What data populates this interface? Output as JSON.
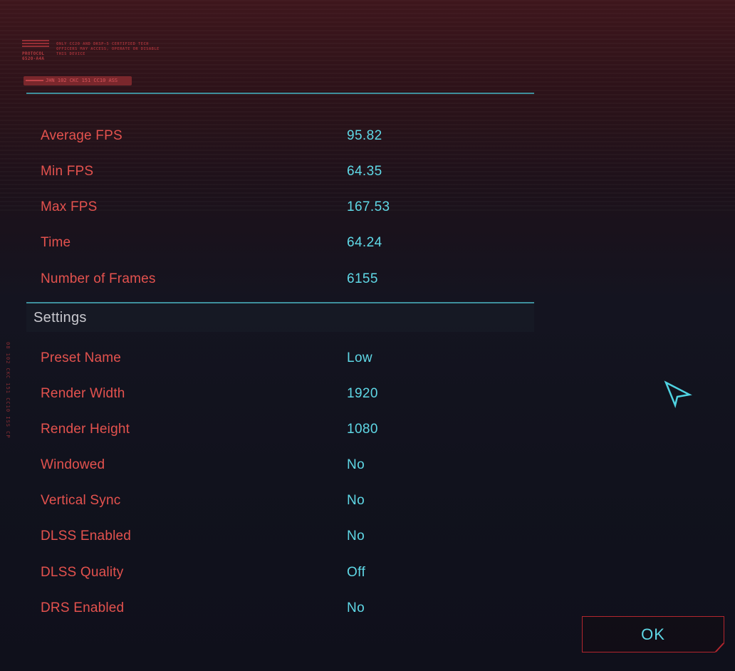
{
  "header": {
    "logo_text": "PROTOCOL 6520-A4A",
    "notice": "ONLY CC20 AND DKSP-5 CERTIFIED TECH OFFICERS MAY ACCESS, OPERATE OR DISABLE THIS DEVICE",
    "tag": "JHN 102 CKC 151 CC10 ASS",
    "side_code": "08 102 CKC 151 CC10 ISS CP"
  },
  "results": [
    {
      "label": "Average FPS",
      "value": "95.82"
    },
    {
      "label": "Min FPS",
      "value": "64.35"
    },
    {
      "label": "Max FPS",
      "value": "167.53"
    },
    {
      "label": "Time",
      "value": "64.24"
    },
    {
      "label": "Number of Frames",
      "value": "6155"
    }
  ],
  "settings": {
    "title": "Settings",
    "items": [
      {
        "label": "Preset Name",
        "value": "Low"
      },
      {
        "label": "Render Width",
        "value": "1920"
      },
      {
        "label": "Render Height",
        "value": "1080"
      },
      {
        "label": "Windowed",
        "value": "No"
      },
      {
        "label": "Vertical Sync",
        "value": "No"
      },
      {
        "label": "DLSS Enabled",
        "value": "No"
      },
      {
        "label": "DLSS Quality",
        "value": "Off"
      },
      {
        "label": "DRS Enabled",
        "value": "No"
      }
    ]
  },
  "ok_button": {
    "label": "OK"
  },
  "icons": {
    "cursor": "cursor-arrow-icon",
    "logo": "protocol-logo-icon"
  },
  "colors": {
    "label": "#e4524e",
    "value": "#5fd8e6",
    "rule": "#3e8f9c",
    "button_border": "#b3262e"
  }
}
